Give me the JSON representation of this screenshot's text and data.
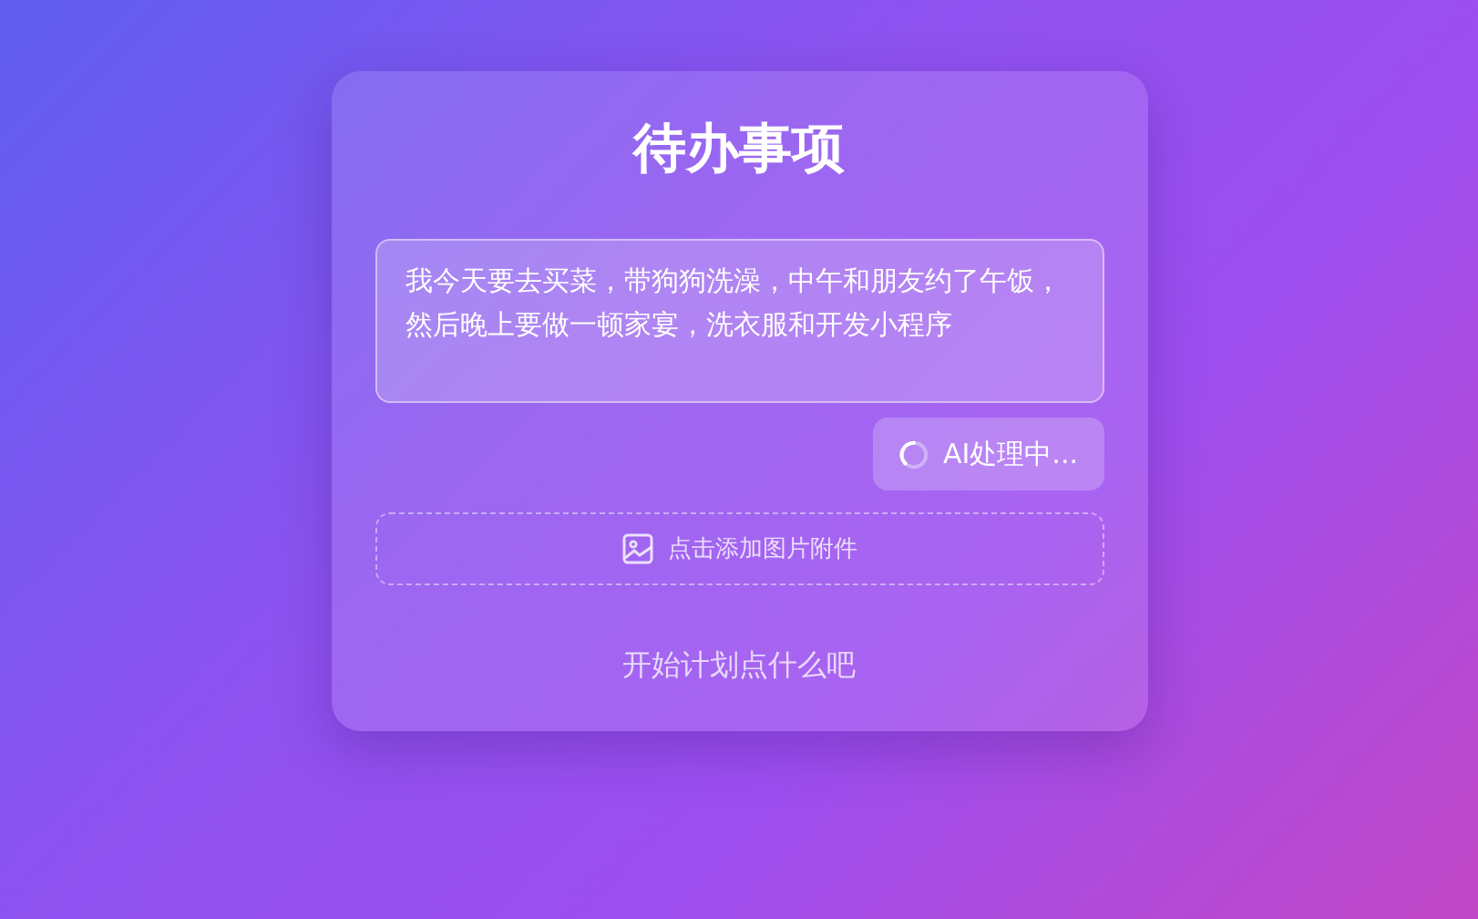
{
  "title": "待办事项",
  "input": {
    "value": "我今天要去买菜，带狗狗洗澡，中午和朋友约了午饭，然后晚上要做一顿家宴，洗衣服和开发小程序"
  },
  "submit_button": {
    "label": "AI处理中...",
    "loading": true
  },
  "attachment": {
    "label": "点击添加图片附件"
  },
  "empty_message": "开始计划点什么吧"
}
